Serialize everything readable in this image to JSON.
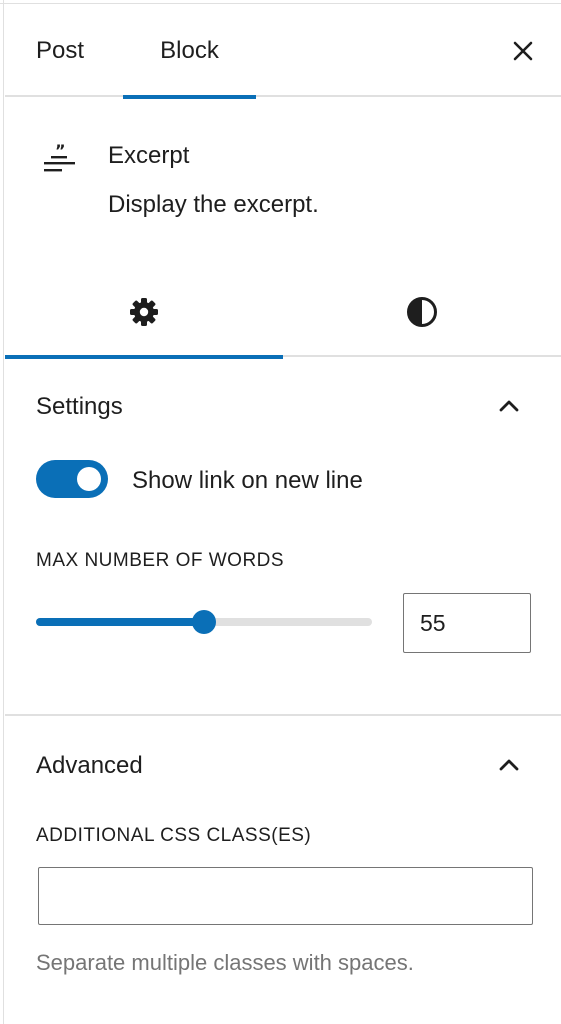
{
  "header": {
    "tabs": [
      {
        "label": "Post"
      },
      {
        "label": "Block"
      }
    ],
    "close_label": "Close settings"
  },
  "block": {
    "icon": "excerpt-icon",
    "title": "Excerpt",
    "description": "Display the excerpt."
  },
  "inspector_tabs": [
    {
      "icon": "gear-icon",
      "label": "Settings"
    },
    {
      "icon": "contrast-icon",
      "label": "Styles"
    }
  ],
  "settings": {
    "title": "Settings",
    "toggle": {
      "label": "Show link on new line",
      "on": true
    },
    "max_words": {
      "label": "MAX NUMBER OF WORDS",
      "value": "55",
      "slider_fraction": 0.5
    }
  },
  "advanced": {
    "title": "Advanced",
    "css_label": "ADDITIONAL CSS CLASS(ES)",
    "css_value": "",
    "help": "Separate multiple classes with spaces."
  },
  "colors": {
    "accent": "#0a6fb7",
    "border": "#e0e0e0",
    "text": "#1e1e1e",
    "muted": "#757575"
  }
}
